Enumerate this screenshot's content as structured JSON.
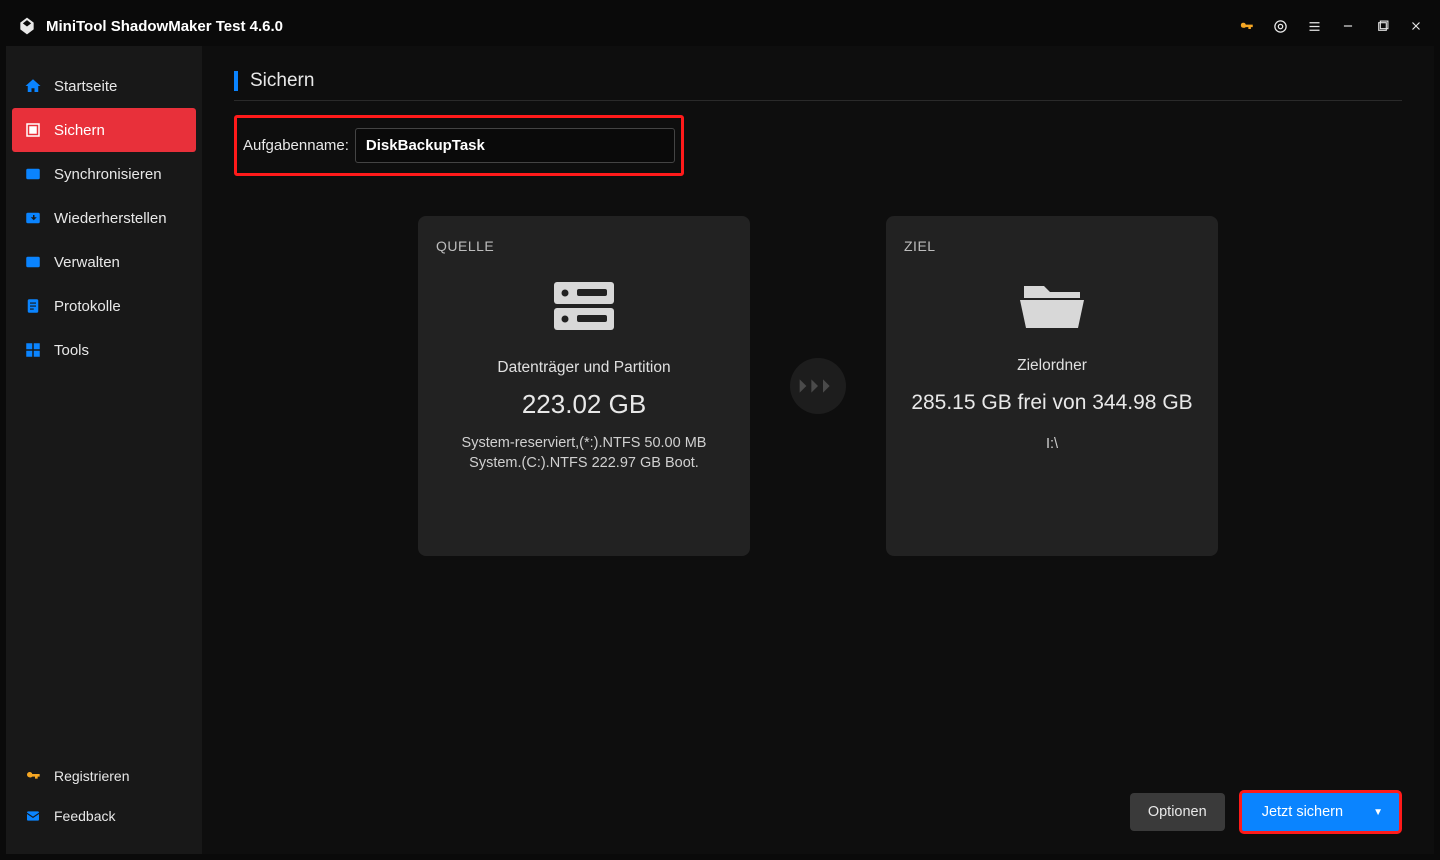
{
  "title": "MiniTool ShadowMaker Test 4.6.0",
  "sidebar": {
    "items": [
      {
        "label": "Startseite"
      },
      {
        "label": "Sichern"
      },
      {
        "label": "Synchronisieren"
      },
      {
        "label": "Wiederherstellen"
      },
      {
        "label": "Verwalten"
      },
      {
        "label": "Protokolle"
      },
      {
        "label": "Tools"
      }
    ],
    "bottom": [
      {
        "label": "Registrieren"
      },
      {
        "label": "Feedback"
      }
    ]
  },
  "page": {
    "heading": "Sichern",
    "task_label": "Aufgabenname:",
    "task_value": "DiskBackupTask"
  },
  "source": {
    "title": "QUELLE",
    "type_label": "Datenträger und Partition",
    "size": "223.02 GB",
    "detail": "System-reserviert,(*:).NTFS 50.00 MB System.(C:).NTFS 222.97 GB Boot."
  },
  "target": {
    "title": "ZIEL",
    "type_label": "Zielordner",
    "space": "285.15 GB frei von 344.98 GB",
    "path": "I:\\"
  },
  "footer": {
    "options": "Optionen",
    "backup_now": "Jetzt sichern"
  }
}
